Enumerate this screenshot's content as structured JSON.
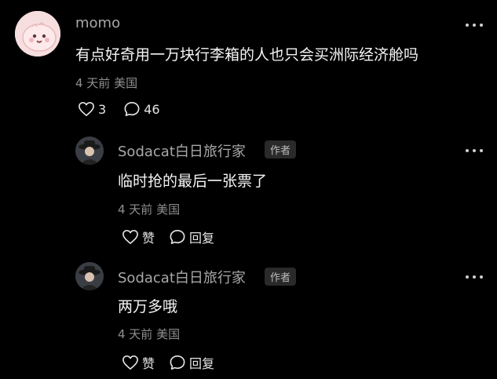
{
  "comments": [
    {
      "username": "momo",
      "text": "有点好奇用一万块行李箱的人也只会买洲际经济舱吗",
      "time": "4 天前",
      "location": "美国",
      "like_label": "3",
      "reply_label": "46",
      "avatar_icon": "pink-blob-avatar"
    }
  ],
  "replies": [
    {
      "username": "Sodacat白日旅行家",
      "author_badge": "作者",
      "text": "临时抢的最后一张票了",
      "time": "4 天前",
      "location": "美国",
      "like_label": "赞",
      "reply_label": "回复",
      "avatar_icon": "hat-person-avatar"
    },
    {
      "username": "Sodacat白日旅行家",
      "author_badge": "作者",
      "text": "两万多哦",
      "time": "4 天前",
      "location": "美国",
      "like_label": "赞",
      "reply_label": "回复",
      "avatar_icon": "hat-person-avatar"
    }
  ],
  "colors": {
    "background": "#000000",
    "username": "#a8a8a8",
    "meta": "#8f8f8f",
    "badge_bg": "#2a2a2a"
  }
}
